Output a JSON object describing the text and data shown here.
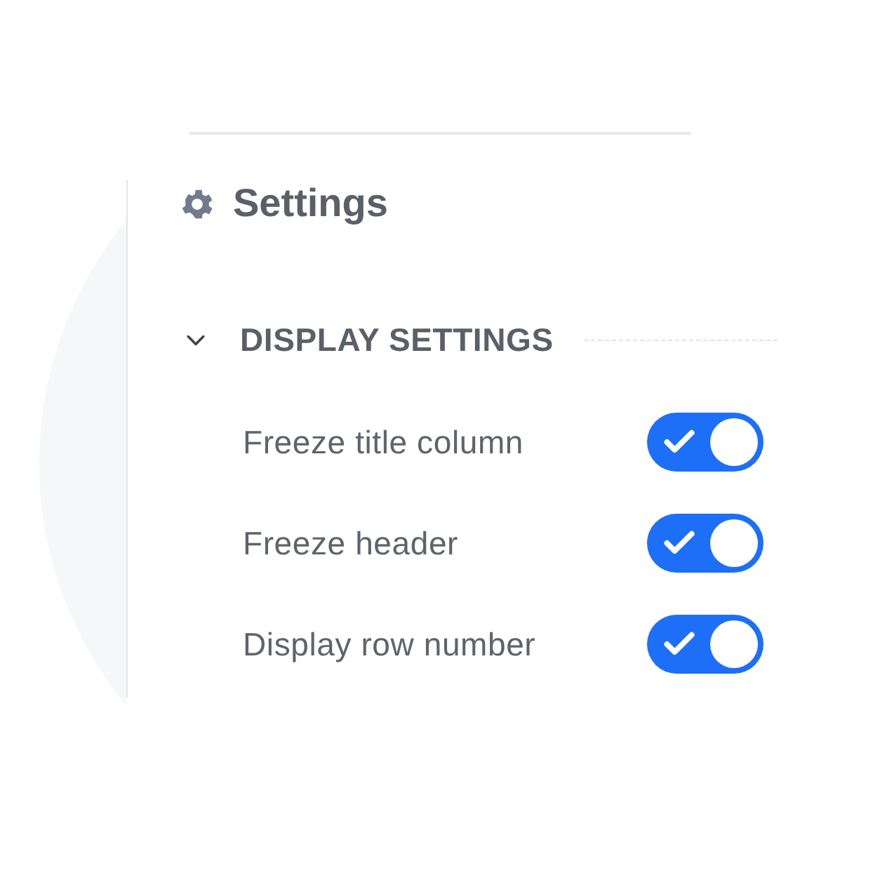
{
  "panel": {
    "title": "Settings"
  },
  "section": {
    "title": "DISPLAY SETTINGS",
    "expanded": true,
    "options": [
      {
        "label": "Freeze title column",
        "checked": true
      },
      {
        "label": "Freeze header",
        "checked": true
      },
      {
        "label": "Display row number",
        "checked": true
      }
    ]
  }
}
